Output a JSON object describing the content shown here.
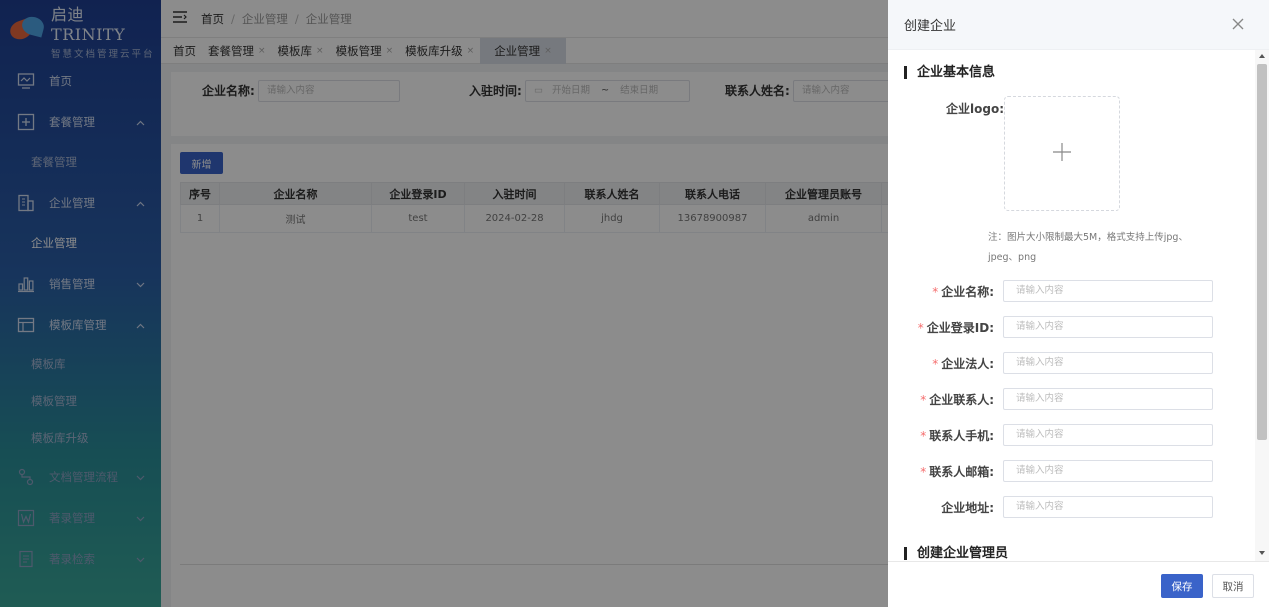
{
  "brand": {
    "name": "启迪 TRINITY",
    "subtitle": "智慧文档管理云平台"
  },
  "sidebar": {
    "items": [
      {
        "label": "首页",
        "icon": "monitor-icon"
      },
      {
        "label": "套餐管理",
        "icon": "plus-square-icon",
        "expanded": true,
        "children": [
          "套餐管理"
        ]
      },
      {
        "label": "企业管理",
        "icon": "building-icon",
        "expanded": true,
        "children": [
          "企业管理"
        ]
      },
      {
        "label": "销售管理",
        "icon": "bar-chart-icon",
        "expanded": false
      },
      {
        "label": "模板库管理",
        "icon": "template-icon",
        "expanded": true,
        "children": [
          "模板库",
          "模板管理",
          "模板库升级"
        ]
      },
      {
        "label": "文档管理流程",
        "icon": "flow-icon",
        "expanded": false
      },
      {
        "label": "著录管理",
        "icon": "word-icon",
        "expanded": false
      },
      {
        "label": "著录检索",
        "icon": "document-icon",
        "expanded": false
      }
    ],
    "sub": {
      "package": "套餐管理",
      "enterprise": "企业管理",
      "template_lib": "模板库",
      "template_mgmt": "模板管理",
      "template_upgrade": "模板库升级"
    }
  },
  "breadcrumb": {
    "home": "首页",
    "level1": "企业管理",
    "level2": "企业管理",
    "sep": "/"
  },
  "tabs": [
    {
      "label": "首页",
      "closable": false
    },
    {
      "label": "套餐管理",
      "closable": true
    },
    {
      "label": "模板库",
      "closable": true
    },
    {
      "label": "模板管理",
      "closable": true
    },
    {
      "label": "模板库升级",
      "closable": true
    },
    {
      "label": "企业管理",
      "closable": true,
      "active": true
    }
  ],
  "filter": {
    "name_label": "企业名称:",
    "name_placeholder": "请输入内容",
    "date_label": "入驻时间:",
    "date_start": "开始日期",
    "date_tilde": "~",
    "date_end": "结束日期",
    "contact_label": "联系人姓名:",
    "contact_placeholder": "请输入内容"
  },
  "table": {
    "add_label": "新增",
    "headers": [
      "序号",
      "企业名称",
      "企业登录ID",
      "入驻时间",
      "联系人姓名",
      "联系人电话",
      "企业管理员账号"
    ],
    "rows": [
      [
        "1",
        "测试",
        "test",
        "2024-02-28",
        "jhdg",
        "13678900987",
        "admin"
      ]
    ]
  },
  "drawer": {
    "title": "创建企业",
    "section1": "企业基本信息",
    "section2": "创建企业管理员",
    "logo_label": "企业logo:",
    "upload_icon": "plus-icon",
    "note": "注：图片大小限制最大5M，格式支持上传jpg、jpeg、png",
    "fields": [
      {
        "label": "企业名称:",
        "required": true,
        "placeholder": "请输入内容"
      },
      {
        "label": "企业登录ID:",
        "required": true,
        "placeholder": "请输入内容"
      },
      {
        "label": "企业法人:",
        "required": true,
        "placeholder": "请输入内容"
      },
      {
        "label": "企业联系人:",
        "required": true,
        "placeholder": "请输入内容"
      },
      {
        "label": "联系人手机:",
        "required": true,
        "placeholder": "请输入内容"
      },
      {
        "label": "联系人邮箱:",
        "required": true,
        "placeholder": "请输入内容"
      },
      {
        "label": "企业地址:",
        "required": false,
        "placeholder": "请输入内容"
      }
    ],
    "required_mark": "*",
    "save_label": "保存",
    "cancel_label": "取消"
  },
  "colors": {
    "primary": "#3a63c9",
    "required": "#f56c6c",
    "sidebar_top": "#1f3f93",
    "sidebar_bottom": "#3aa89a"
  }
}
